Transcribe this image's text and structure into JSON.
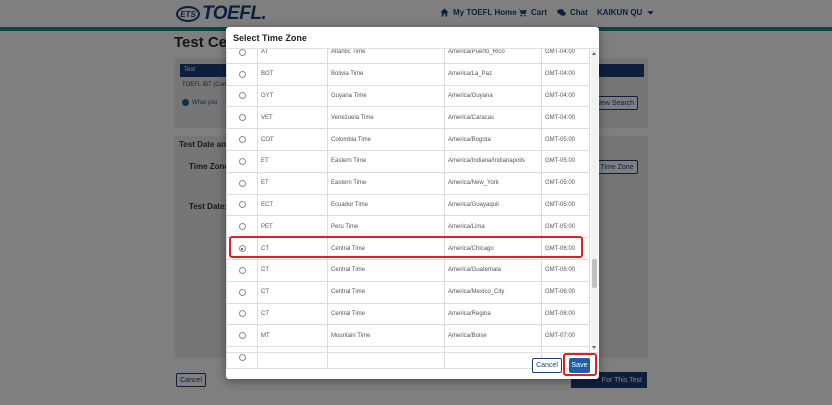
{
  "header": {
    "logo_ets": "ETS",
    "logo_product": "TOEFL.",
    "nav": {
      "home": "My TOEFL Home",
      "cart": "Cart",
      "chat": "Chat",
      "user": "KAIKUN QU"
    }
  },
  "background": {
    "page_title": "Test Ce",
    "table_header": "Test",
    "row_text": "TOEFL iBT (Com",
    "info_link": "What you",
    "new_search_btn": "New Search",
    "section_label": "Test Date and",
    "time_zone_label": "Time Zone:",
    "time_zone_btn": "Time Zone",
    "test_date_label": "Test Date:",
    "cancel_btn": "Cancel",
    "cta_btn": "For This Test"
  },
  "modal": {
    "title": "Select Time Zone",
    "rows": [
      {
        "abbr": "AT",
        "name": "Atlantic Time",
        "zone": "America/Puerto_Rico",
        "offset": "GMT-04:00",
        "selected": false
      },
      {
        "abbr": "BOT",
        "name": "Bolivia Time",
        "zone": "America/La_Paz",
        "offset": "GMT-04:00",
        "selected": false
      },
      {
        "abbr": "GYT",
        "name": "Guyana Time",
        "zone": "America/Guyana",
        "offset": "GMT-04:00",
        "selected": false
      },
      {
        "abbr": "VET",
        "name": "Venezuela Time",
        "zone": "America/Caracas",
        "offset": "GMT-04:00",
        "selected": false
      },
      {
        "abbr": "COT",
        "name": "Colombia Time",
        "zone": "America/Bogota",
        "offset": "GMT-05:00",
        "selected": false
      },
      {
        "abbr": "ET",
        "name": "Eastern Time",
        "zone": "America/Indiana/Indianapolis",
        "offset": "GMT-05:00",
        "selected": false
      },
      {
        "abbr": "ET",
        "name": "Eastern Time",
        "zone": "America/New_York",
        "offset": "GMT-05:00",
        "selected": false
      },
      {
        "abbr": "ECT",
        "name": "Ecuador Time",
        "zone": "America/Guayaquil",
        "offset": "GMT-05:00",
        "selected": false
      },
      {
        "abbr": "PET",
        "name": "Peru Time",
        "zone": "America/Lima",
        "offset": "GMT-05:00",
        "selected": false
      },
      {
        "abbr": "CT",
        "name": "Central Time",
        "zone": "America/Chicago",
        "offset": "GMT-06:00",
        "selected": true
      },
      {
        "abbr": "CT",
        "name": "Central Time",
        "zone": "America/Guatemala",
        "offset": "GMT-06:00",
        "selected": false
      },
      {
        "abbr": "CT",
        "name": "Central Time",
        "zone": "America/Mexico_City",
        "offset": "GMT-06:00",
        "selected": false
      },
      {
        "abbr": "CT",
        "name": "Central Time",
        "zone": "America/Regina",
        "offset": "GMT-06:00",
        "selected": false
      },
      {
        "abbr": "MT",
        "name": "Mountain Time",
        "zone": "America/Boise",
        "offset": "GMT-07:00",
        "selected": false
      },
      {
        "abbr": "",
        "name": "",
        "zone": "",
        "offset": "",
        "selected": false
      }
    ],
    "cancel_label": "Cancel",
    "save_label": "Save"
  },
  "colors": {
    "brand_navy": "#1c3f7a",
    "accent_teal": "#1a8a87",
    "save_blue": "#1c5fa8",
    "highlight_red": "#e02020"
  },
  "scroll": {
    "thumb_position": 0.78,
    "thumb_fraction": 0.1
  }
}
